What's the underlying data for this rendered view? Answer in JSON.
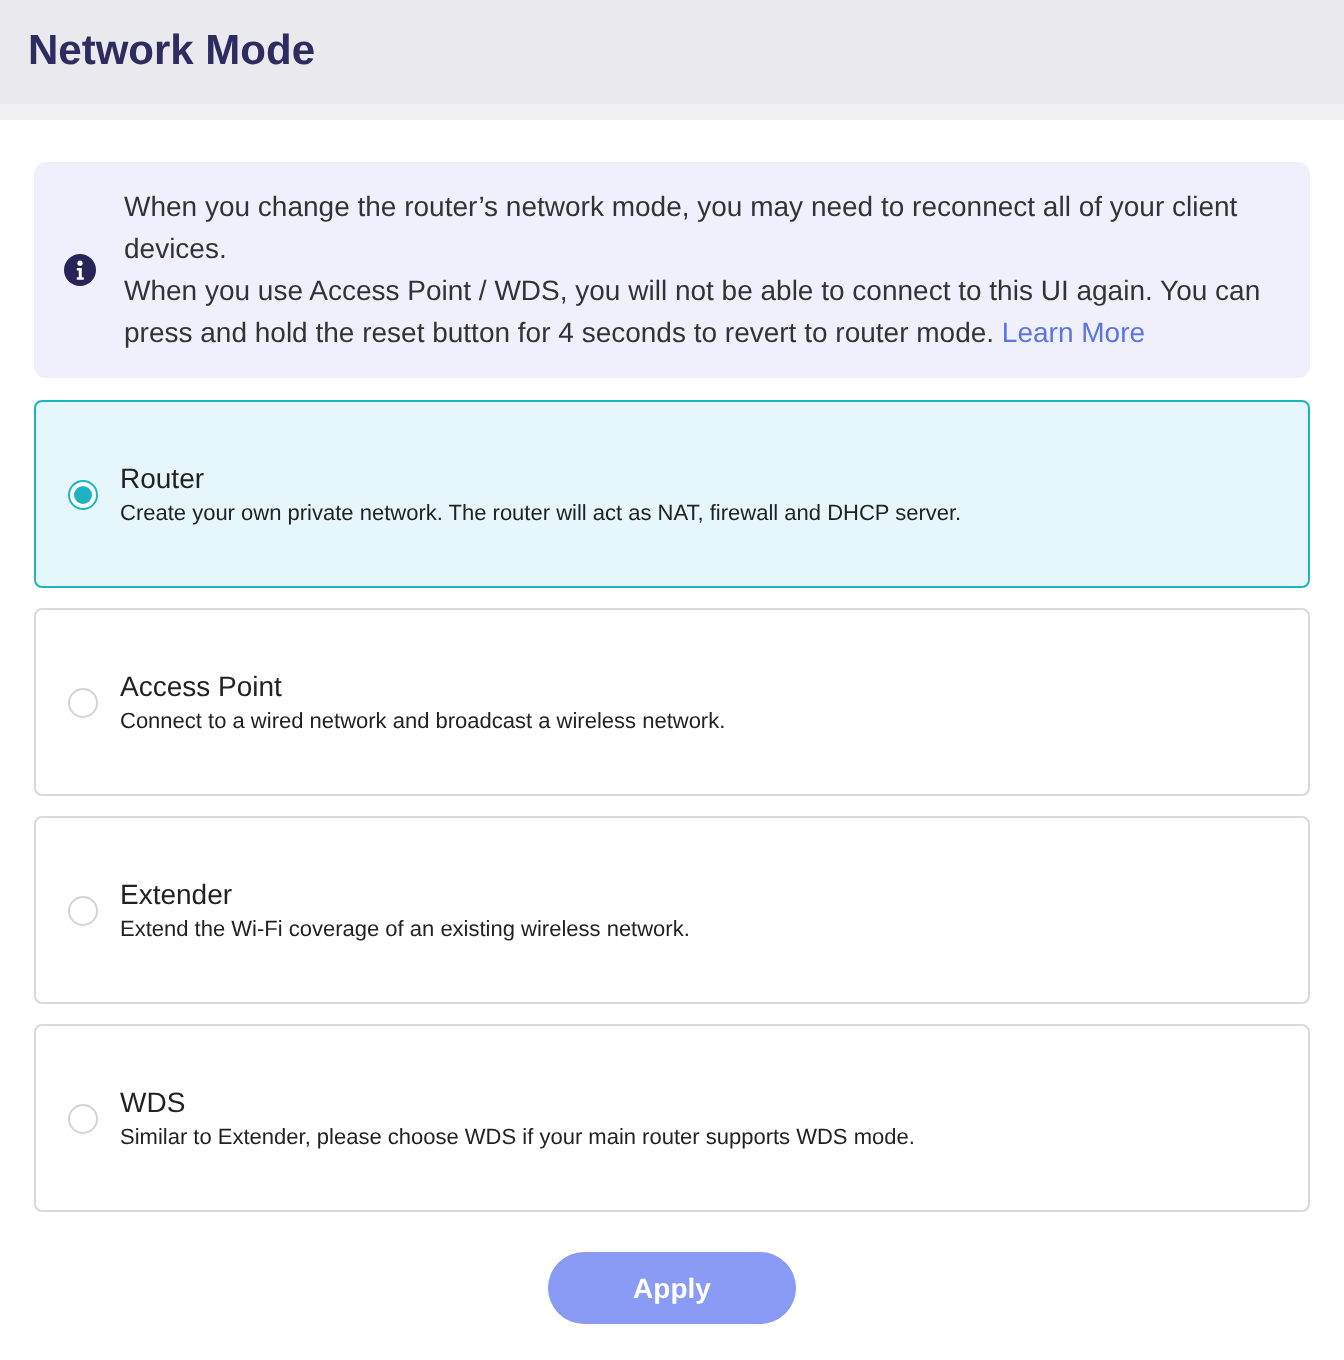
{
  "page": {
    "title": "Network Mode"
  },
  "notice": {
    "paragraphs": [
      {
        "text": "When you change the router’s network mode, you may need to reconnect all of your client devices."
      },
      {
        "text": "When you use Access Point / WDS, you will not be able to connect to this UI again. You can press and hold the reset button for 4 seconds to revert to router mode.",
        "link": "Learn More"
      }
    ]
  },
  "modes": [
    {
      "title": "Router",
      "description": "Create your own private network. The router will act as NAT, firewall and DHCP server.",
      "selected": true
    },
    {
      "title": "Access Point",
      "description": "Connect to a wired network and broadcast a wireless network.",
      "selected": false
    },
    {
      "title": "Extender",
      "description": "Extend the Wi-Fi coverage of an existing wireless network.",
      "selected": false
    },
    {
      "title": "WDS",
      "description": "Similar to Extender, please choose WDS if your main router supports WDS mode.",
      "selected": false
    }
  ],
  "apply_button": {
    "label": "Apply",
    "disabled": true
  }
}
